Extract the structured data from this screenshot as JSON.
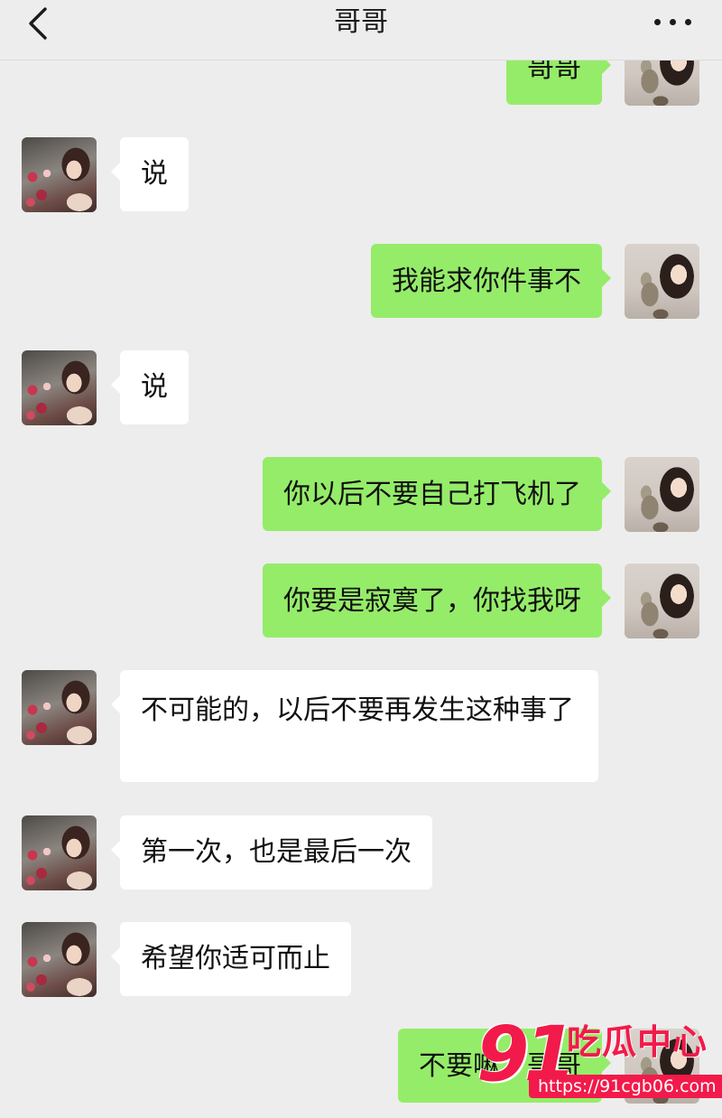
{
  "header": {
    "title": "哥哥",
    "back_icon": "chevron-left-icon",
    "more_icon": "more-dots-icon"
  },
  "colors": {
    "background": "#ededed",
    "incoming_bubble": "#ffffff",
    "outgoing_bubble": "#95ec69",
    "watermark": "#f21a4a"
  },
  "messages": [
    {
      "direction": "outgoing",
      "text": "哥哥"
    },
    {
      "direction": "incoming",
      "text": "说"
    },
    {
      "direction": "outgoing",
      "text": "我能求你件事不"
    },
    {
      "direction": "incoming",
      "text": "说"
    },
    {
      "direction": "outgoing",
      "text": "你以后不要自己打飞机了"
    },
    {
      "direction": "outgoing",
      "text": "你要是寂寞了，你找我呀"
    },
    {
      "direction": "incoming",
      "text": "不可能的，以后不要再发生这种事了"
    },
    {
      "direction": "incoming",
      "text": "第一次，也是最后一次"
    },
    {
      "direction": "incoming",
      "text": "希望你适可而止"
    },
    {
      "direction": "outgoing",
      "text": "不要嘛。哥哥"
    }
  ],
  "watermark": {
    "number": "91",
    "site_name": "吃瓜中心",
    "url": "https://91cgb06.com"
  }
}
